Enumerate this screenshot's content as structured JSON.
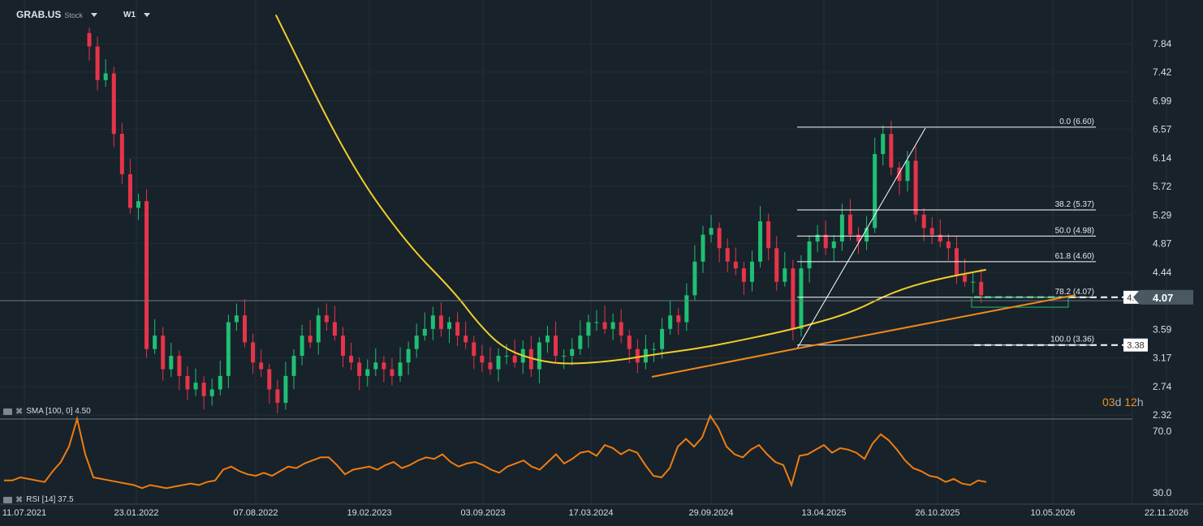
{
  "header": {
    "symbol": "GRAB.US",
    "type": "Stock",
    "timeframe": "W1"
  },
  "indicators": {
    "sma_label": "SMA [100,  0] 4.50",
    "rsi_label": "RSI [14] 37.5"
  },
  "countdown": {
    "days": "03",
    "d": "d",
    "hours": "12",
    "h": "h"
  },
  "colors": {
    "up": "#1fbf73",
    "down": "#e6344a",
    "sma": "#f2cd2a",
    "rsi": "#f07c12",
    "trend": "#f08a1c",
    "bg": "#18222a"
  },
  "chart_data": {
    "type": "candlestick",
    "title": "GRAB.US Stock W1",
    "x_tick_labels": [
      "11.07.2021",
      "23.01.2022",
      "07.08.2022",
      "19.02.2023",
      "03.09.2023",
      "17.03.2024",
      "29.09.2024",
      "13.04.2025",
      "26.10.2025",
      "10.05.2026",
      "22.11.2026"
    ],
    "y_tick_labels": [
      "7.84",
      "7.42",
      "6.99",
      "6.57",
      "6.14",
      "5.72",
      "5.29",
      "4.87",
      "4.44",
      "3.59",
      "3.17",
      "2.74",
      "2.32"
    ],
    "ylim": [
      2.32,
      7.84
    ],
    "current_price": "4.07",
    "close": [
      7.8,
      7.3,
      7.4,
      6.5,
      5.9,
      5.4,
      5.5,
      3.3,
      3.5,
      3.0,
      3.2,
      2.9,
      2.7,
      2.8,
      2.6,
      2.7,
      2.9,
      3.7,
      3.8,
      3.4,
      3.1,
      3.0,
      2.7,
      2.5,
      2.9,
      3.2,
      3.5,
      3.4,
      3.8,
      3.7,
      3.5,
      3.2,
      3.1,
      2.9,
      3.0,
      3.1,
      3.0,
      2.9,
      3.1,
      3.3,
      3.5,
      3.6,
      3.8,
      3.6,
      3.7,
      3.5,
      3.4,
      3.2,
      3.1,
      3.0,
      3.2,
      3.2,
      3.1,
      3.3,
      3.0,
      3.4,
      3.5,
      3.2,
      3.2,
      3.3,
      3.5,
      3.7,
      3.7,
      3.6,
      3.7,
      3.5,
      3.3,
      3.1,
      3.3,
      3.3,
      3.6,
      3.8,
      3.7,
      4.1,
      4.6,
      5.0,
      5.1,
      4.8,
      4.6,
      4.5,
      4.3,
      4.6,
      5.2,
      4.8,
      4.3,
      4.5,
      3.6,
      4.5,
      4.9,
      5.0,
      4.8,
      4.9,
      5.3,
      5.0,
      4.9,
      5.1,
      6.2,
      6.5,
      6.0,
      5.8,
      6.1,
      5.3,
      5.1,
      5.0,
      4.9,
      4.8,
      4.4,
      4.3,
      4.3,
      4.1
    ],
    "sma_100": [
      [
        22.8,
        8.27
      ],
      [
        31.7,
        6.08
      ],
      [
        38.7,
        4.88
      ],
      [
        44.6,
        4.15
      ],
      [
        47.6,
        3.67
      ],
      [
        50.6,
        3.31
      ],
      [
        54.6,
        3.13
      ],
      [
        58.6,
        3.07
      ],
      [
        64.5,
        3.13
      ],
      [
        68.5,
        3.21
      ],
      [
        74.4,
        3.31
      ],
      [
        78.4,
        3.4
      ],
      [
        84.3,
        3.55
      ],
      [
        88.3,
        3.67
      ],
      [
        93.3,
        3.85
      ],
      [
        98.2,
        4.15
      ],
      [
        103.2,
        4.33
      ],
      [
        109.6,
        4.48
      ]
    ],
    "fibonacci": [
      {
        "label": "0.0 (6.60)",
        "price": 6.6
      },
      {
        "label": "38.2 (5.37)",
        "price": 5.37
      },
      {
        "label": "50.0 (4.98)",
        "price": 4.98
      },
      {
        "label": "61.8 (4.60)",
        "price": 4.6
      },
      {
        "label": "78.2 (4.07)",
        "price": 4.07,
        "tag": "4.08"
      },
      {
        "label": "100.0 (3.36)",
        "price": 3.36,
        "tag": "3.38"
      }
    ],
    "rsi": {
      "y_tick_labels": [
        "70.0",
        "30.0"
      ],
      "ylim": [
        30,
        70
      ],
      "values": [
        38,
        38,
        40,
        39,
        38,
        37,
        44,
        50,
        60,
        78,
        55,
        40,
        39,
        38,
        37,
        36,
        35,
        33,
        35,
        34,
        33,
        34,
        35,
        36,
        35,
        37,
        38,
        45,
        47,
        44,
        42,
        41,
        43,
        41,
        44,
        47,
        46,
        49,
        51,
        53,
        53,
        48,
        42,
        45,
        46,
        47,
        45,
        48,
        50,
        46,
        48,
        51,
        53,
        52,
        55,
        50,
        47,
        49,
        50,
        48,
        45,
        43,
        47,
        49,
        51,
        47,
        45,
        50,
        55,
        49,
        52,
        56,
        57,
        54,
        61,
        59,
        55,
        58,
        56,
        48,
        41,
        40,
        46,
        60,
        65,
        60,
        66,
        80,
        72,
        60,
        55,
        53,
        58,
        61,
        55,
        50,
        48,
        35,
        54,
        55,
        58,
        61,
        56,
        59,
        58,
        56,
        52,
        62,
        68,
        64,
        58,
        51,
        46,
        44,
        41,
        40,
        37,
        39,
        36,
        35,
        38,
        37
      ]
    }
  }
}
